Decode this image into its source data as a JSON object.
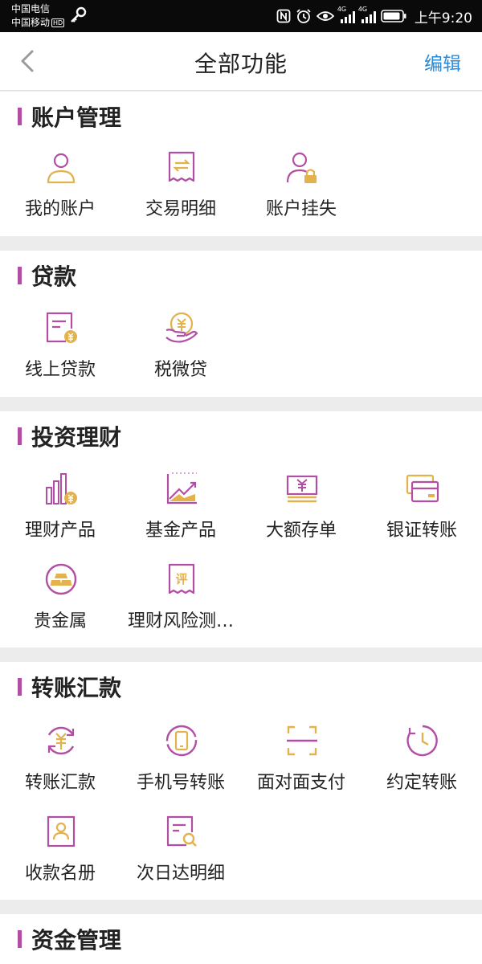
{
  "status_bar": {
    "carrier1": "中国电信",
    "carrier2": "中国移动",
    "hd_badge": "HD",
    "network1": "4G",
    "network2": "4G",
    "time": "上午9:20"
  },
  "header": {
    "title": "全部功能",
    "edit_label": "编辑"
  },
  "colors": {
    "accent": "#b24fa4",
    "gold": "#e3b24d",
    "link": "#2a8ad8"
  },
  "sections": [
    {
      "title": "账户管理",
      "items": [
        {
          "label": "我的账户",
          "icon": "user-icon"
        },
        {
          "label": "交易明细",
          "icon": "receipt-icon"
        },
        {
          "label": "账户挂失",
          "icon": "user-lock-icon"
        }
      ]
    },
    {
      "title": "贷款",
      "items": [
        {
          "label": "线上贷款",
          "icon": "loan-document-icon"
        },
        {
          "label": "税微贷",
          "icon": "hand-coin-icon"
        }
      ]
    },
    {
      "title": "投资理财",
      "items": [
        {
          "label": "理财产品",
          "icon": "bar-chart-coin-icon"
        },
        {
          "label": "基金产品",
          "icon": "trend-chart-icon"
        },
        {
          "label": "大额存单",
          "icon": "deposit-certificate-icon"
        },
        {
          "label": "银证转账",
          "icon": "cards-icon"
        },
        {
          "label": "贵金属",
          "icon": "gold-bar-icon"
        },
        {
          "label": "理财风险测…",
          "icon": "evaluation-icon"
        }
      ]
    },
    {
      "title": "转账汇款",
      "items": [
        {
          "label": "转账汇款",
          "icon": "yuan-cycle-icon"
        },
        {
          "label": "手机号转账",
          "icon": "phone-icon"
        },
        {
          "label": "面对面支付",
          "icon": "scan-icon"
        },
        {
          "label": "约定转账",
          "icon": "clock-icon"
        },
        {
          "label": "收款名册",
          "icon": "contact-book-icon"
        },
        {
          "label": "次日达明细",
          "icon": "document-search-icon"
        }
      ]
    },
    {
      "title": "资金管理",
      "items": []
    }
  ]
}
